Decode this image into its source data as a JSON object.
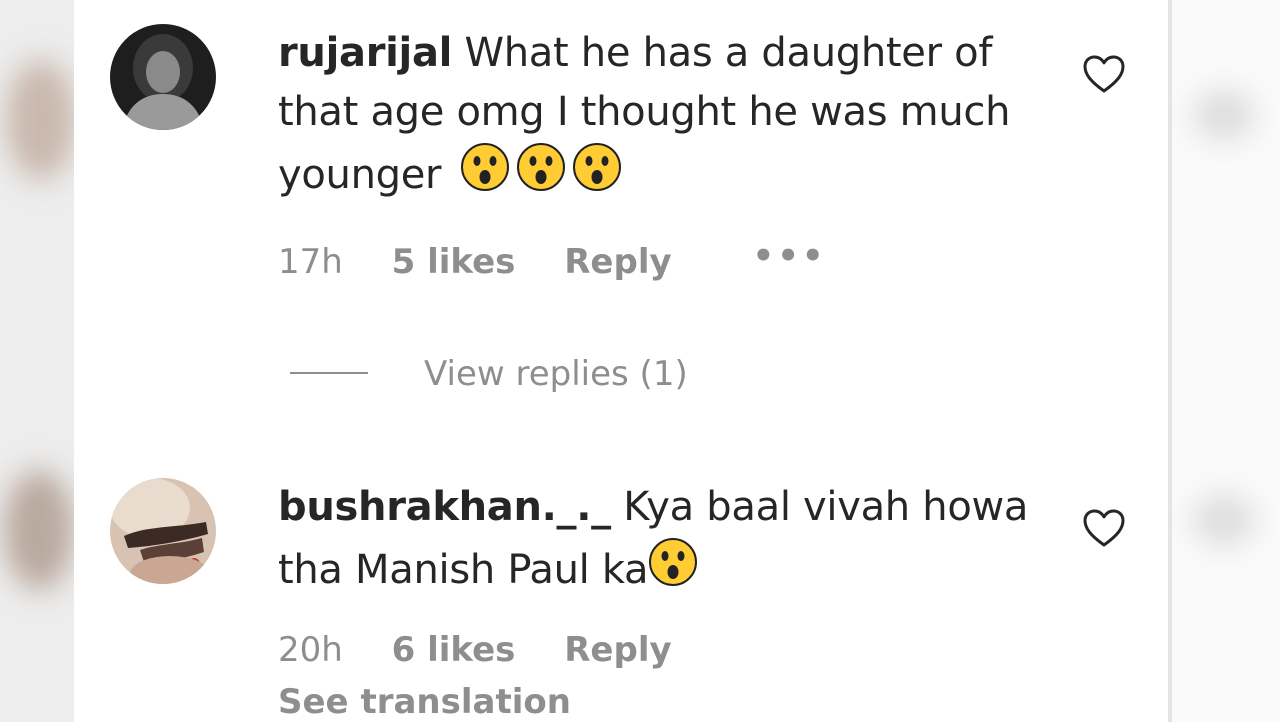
{
  "comments": [
    {
      "username": "rujarijal",
      "text": "What he has a daughter of that age omg I thought he was much younger",
      "emojis": [
        "hushed-face",
        "hushed-face",
        "hushed-face"
      ],
      "timestamp": "17h",
      "likes": "5 likes",
      "reply_label": "Reply",
      "more_label": "•••",
      "view_replies_label": "View replies (1)"
    },
    {
      "username": "bushrakhan._._",
      "text": "Kya baal vivah howa tha Manish Paul ka",
      "emojis": [
        "hushed-face"
      ],
      "timestamp": "20h",
      "likes": "6 likes",
      "reply_label": "Reply",
      "see_translation_label": "See translation"
    }
  ],
  "icons": {
    "like": "heart-outline-icon",
    "emoji": "hushed-face-emoji"
  },
  "colors": {
    "primary_text": "#262626",
    "secondary_text": "#8e8e8e",
    "emoji_yellow": "#ffcc33",
    "background": "#ffffff"
  }
}
